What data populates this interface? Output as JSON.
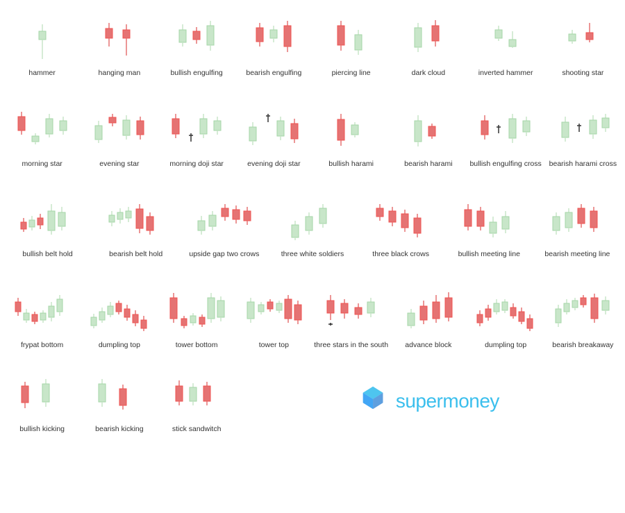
{
  "rows": [
    {
      "patterns": [
        {
          "name": "hammer",
          "label": "hammer"
        },
        {
          "name": "hanging-man",
          "label": "hanging man"
        },
        {
          "name": "bullish-engulfing",
          "label": "bullish engulfing"
        },
        {
          "name": "bearish-engulfing",
          "label": "bearish engulfing"
        },
        {
          "name": "piercing-line",
          "label": "piercing line"
        },
        {
          "name": "dark-cloud",
          "label": "dark cloud"
        },
        {
          "name": "inverted-hammer",
          "label": "inverted hammer"
        },
        {
          "name": "shooting-star",
          "label": "shooting star"
        }
      ]
    },
    {
      "patterns": [
        {
          "name": "morning-star",
          "label": "morning star"
        },
        {
          "name": "evening-star",
          "label": "evening star"
        },
        {
          "name": "morning-doji-star",
          "label": "morning doji star"
        },
        {
          "name": "evening-doji-star",
          "label": "evening doji star"
        },
        {
          "name": "bullish-harami",
          "label": "bullish harami"
        },
        {
          "name": "bearish-harami",
          "label": "bearish harami"
        },
        {
          "name": "bullish-engulfing-cross",
          "label": "bullish engulfing cross"
        },
        {
          "name": "bearish-harami-cross",
          "label": "bearish harami cross"
        }
      ]
    },
    {
      "patterns": [
        {
          "name": "bullish-belt-hold",
          "label": "bullish belt hold"
        },
        {
          "name": "bearish-belt-hold",
          "label": "bearish belt hold"
        },
        {
          "name": "upside-gap-two-crows",
          "label": "upside gap two crows"
        },
        {
          "name": "three-white-soldiers",
          "label": "three white soldiers"
        },
        {
          "name": "three-black-crows",
          "label": "three black crows"
        },
        {
          "name": "bullish-meeting-line",
          "label": "bullish meeting line"
        },
        {
          "name": "bearish-meeting-line",
          "label": "bearish meeting line"
        },
        {
          "name": "empty",
          "label": ""
        }
      ]
    },
    {
      "patterns": [
        {
          "name": "frypat-bottom",
          "label": "frypat bottom"
        },
        {
          "name": "dumpling-top-1",
          "label": "dumpling top"
        },
        {
          "name": "tower-bottom",
          "label": "tower bottom"
        },
        {
          "name": "tower-top",
          "label": "tower top"
        },
        {
          "name": "three-stars-in-south",
          "label": "three stars in the south"
        },
        {
          "name": "advance-block",
          "label": "advance block"
        },
        {
          "name": "dumpling-top-2",
          "label": "dumpling top"
        },
        {
          "name": "bearish-breakaway",
          "label": "bearish breakaway"
        }
      ]
    }
  ],
  "last_row": {
    "patterns": [
      {
        "name": "bullish-kicking",
        "label": "bullish kicking"
      },
      {
        "name": "bearish-kicking",
        "label": "bearish kicking"
      },
      {
        "name": "stick-sandwitch",
        "label": "stick sandwitch"
      }
    ]
  },
  "logo": {
    "text": "supermoney"
  }
}
